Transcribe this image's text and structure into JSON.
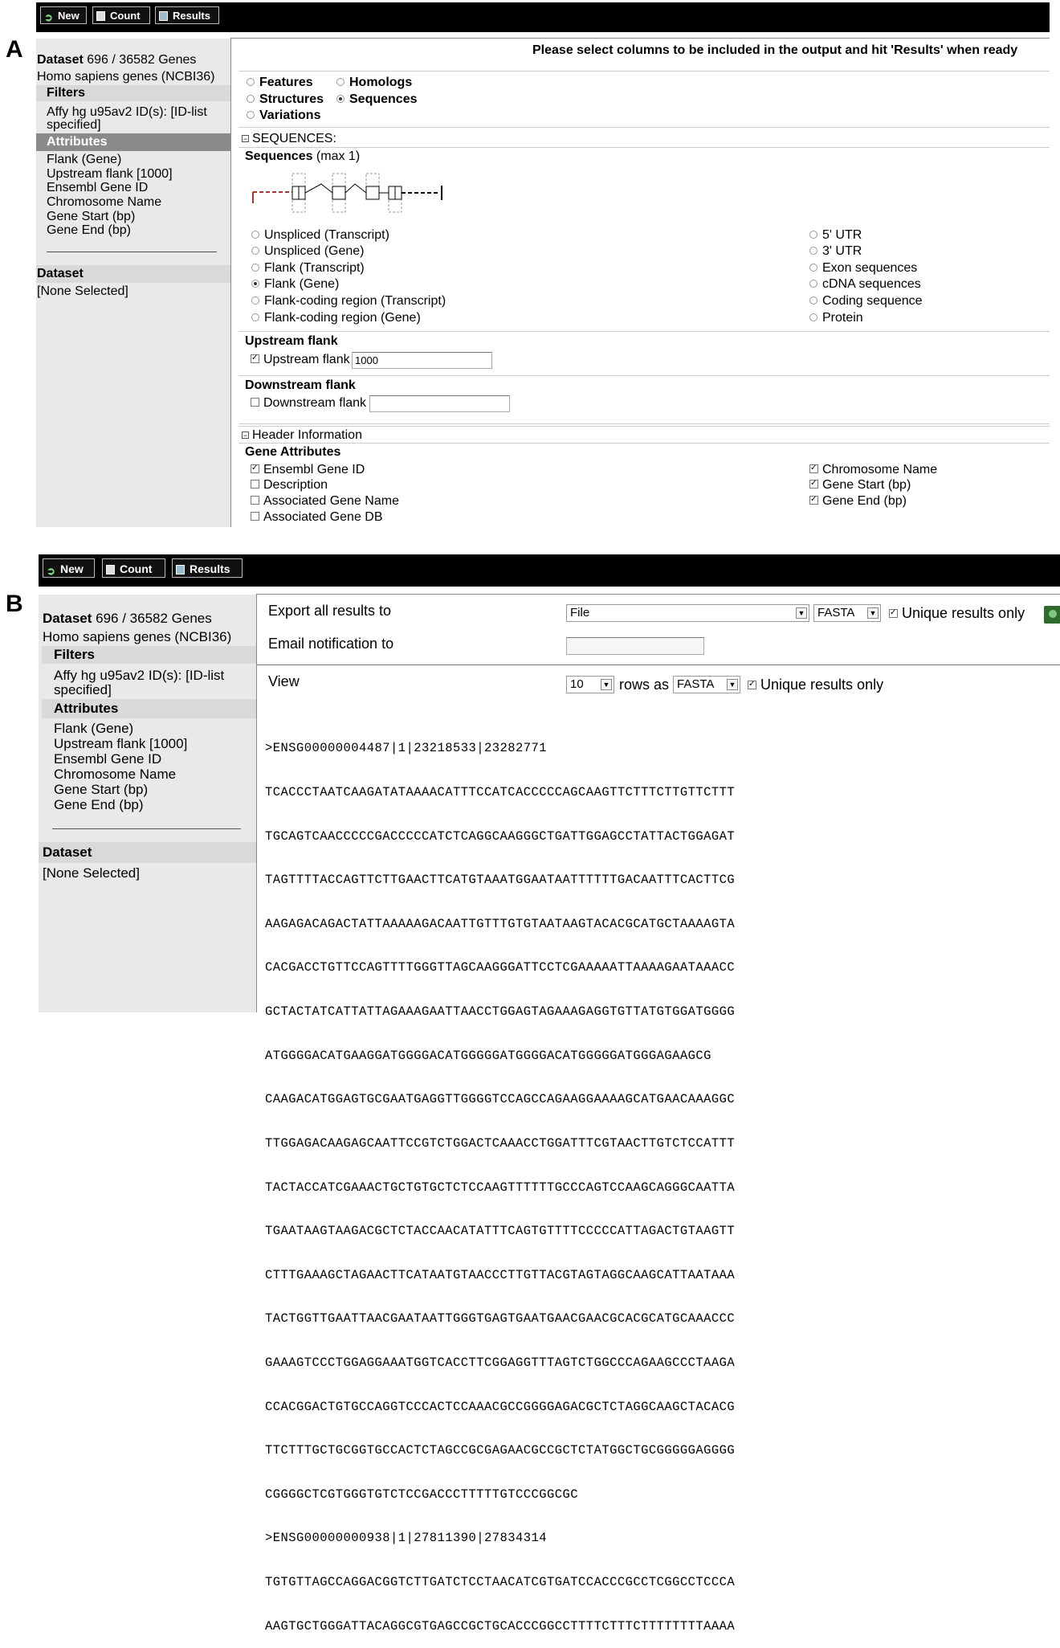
{
  "panel_labels": {
    "a": "A",
    "b": "B"
  },
  "toolbar": {
    "new": "New",
    "count": "Count",
    "results": "Results"
  },
  "sidebar": {
    "dataset_label": "Dataset",
    "dataset_count": " 696 / 36582 Genes",
    "species": "Homo sapiens genes (NCBI36)",
    "filters_head": "Filters",
    "filter_line1": "Affy hg u95av2 ID(s): [ID-list",
    "filter_line2": "specified]",
    "attributes_head": "Attributes",
    "attributes": [
      "Flank (Gene)",
      "Upstream flank [1000]",
      "Ensembl Gene ID",
      "Chromosome Name",
      "Gene Start (bp)",
      "Gene End (bp)"
    ],
    "dataset2_head": "Dataset",
    "dataset2_value": "[None Selected]"
  },
  "panel_a": {
    "instruction": "Please select columns to be included in the output and hit 'Results' when ready",
    "pages": [
      {
        "label": "Features",
        "selected": false
      },
      {
        "label": "Homologs",
        "selected": false
      },
      {
        "label": "Structures",
        "selected": false
      },
      {
        "label": "Sequences",
        "selected": true
      },
      {
        "label": "Variations",
        "selected": false
      }
    ],
    "sequences_section": "SEQUENCES:",
    "sequences_title": "Sequences",
    "sequences_max": " (max 1)",
    "seq_options_left": [
      {
        "label": "Unspliced (Transcript)",
        "selected": false
      },
      {
        "label": "Unspliced (Gene)",
        "selected": false
      },
      {
        "label": "Flank (Transcript)",
        "selected": false
      },
      {
        "label": "Flank (Gene)",
        "selected": true
      },
      {
        "label": "Flank-coding region (Transcript)",
        "selected": false
      },
      {
        "label": "Flank-coding region (Gene)",
        "selected": false
      }
    ],
    "seq_options_right": [
      {
        "label": "5' UTR",
        "selected": false
      },
      {
        "label": "3' UTR",
        "selected": false
      },
      {
        "label": "Exon sequences",
        "selected": false
      },
      {
        "label": "cDNA sequences",
        "selected": false
      },
      {
        "label": "Coding sequence",
        "selected": false
      },
      {
        "label": "Protein",
        "selected": false
      }
    ],
    "upstream_title": "Upstream flank",
    "upstream_label": "Upstream flank",
    "upstream_value": "1000",
    "upstream_checked": true,
    "downstream_title": "Downstream flank",
    "downstream_label": "Downstream flank",
    "downstream_value": "",
    "downstream_checked": false,
    "header_section": "Header Information",
    "gene_attr_title": "Gene Attributes",
    "gene_attr_left": [
      {
        "label": "Ensembl Gene ID",
        "checked": true
      },
      {
        "label": "Description",
        "checked": false
      },
      {
        "label": "Associated Gene Name",
        "checked": false
      },
      {
        "label": "Associated Gene DB",
        "checked": false
      }
    ],
    "gene_attr_right": [
      {
        "label": "Chromosome Name",
        "checked": true
      },
      {
        "label": "Gene Start (bp)",
        "checked": true
      },
      {
        "label": "Gene End (bp)",
        "checked": true
      }
    ]
  },
  "panel_b": {
    "export_label": "Export  all results to",
    "export_target": "File",
    "export_format": "FASTA",
    "unique_label": "Unique results only",
    "email_label": "Email notification to",
    "email_value": "",
    "view_label": "View",
    "rows_value": "10",
    "rows_as": "rows as",
    "view_format": "FASTA",
    "view_unique_label": "Unique results only",
    "sequence_lines": [
      ">ENSG00000004487|1|23218533|23282771",
      "TCACCCTAATCAAGATATAAAACATTTCCATCACCCCCAGCAAGTTCTTTCTTGTTCTTT",
      "TGCAGTCAACCCCCGACCCCCATCTCAGGCAAGGGCTGATTGGAGCCTATTACTGGAGAT",
      "TAGTTTTACCAGTTCTTGAACTTCATGTAAATGGAATAATTTTTTGACAATTTCACTTCG",
      "AAGAGACAGACTATTAAAAAGACAATTGTTTGTGTAATAAGTACACGCATGCTAAAAGTA",
      "CACGACCTGTTCCAGTTTTGGGTTAGCAAGGGATTCCTCGAAAAATTAAAAGAATAAACC",
      "GCTACTATCATTATTAGAAAGAATTAACCTGGAGTAGAAAGAGGTGTTATGTGGATGGGG",
      "ATGGGGACATGAAGGATGGGGACATGGGGGATGGGGACATGGGGGATGGGAGAAGCG",
      "CAAGACATGGAGTGCGAATGAGGTTGGGGTCCAGCCAGAAGGAAAAGCATGAACAAAGGC",
      "TTGGAGACAAGAGCAATTCCGTCTGGACTCAAACCTGGATTTCGTAACTTGTCTCCATTT",
      "TACTACCATCGAAACTGCTGTGCTCTCCAAGTTTTTTGCCCAGTCCAAGCAGGGCAATTA",
      "TGAATAAGTAAGACGCTCTACCAACATATTTCAGTGTTTTCCCCCATTAGACTGTAAGTT",
      "CTTTGAAAGCTAGAACTTCATAATGTAACCCTTGTTACGTAGTAGGCAAGCATTAATAAA",
      "TACTGGTTGAATTAACGAATAATTGGGTGAGTGAATGAACGAACGCACGCATGCAAACCC",
      "GAAAGTCCCTGGAGGAAATGGTCACCTTCGGAGGTTTAGTCTGGCCCAGAAGCCCTAAGA",
      "CCACGGACTGTGCCAGGTCCCACTCCAAACGCCGGGGAGACGCTCTAGGCAAGCTACACG",
      "TTCTTTGCTGCGGTGCCACTCTAGCCGCGAGAACGCCGCTCTATGGCTGCGGGGGAGGGG",
      "CGGGGCTCGTGGGTGTCTCCGACCCTTTTTGTCCCGGCGC",
      ">ENSG00000000938|1|27811390|27834314",
      "TGTGTTAGCCAGGACGGTCTTGATCTCCTAACATCGTGATCCACCCGCCTCGGCCTCCCA",
      "AAGTGCTGGGATTACAGGCGTGAGCCGCTGCACCCGGCCTTTTCTTTCTTTTTTTTAAAA"
    ]
  }
}
